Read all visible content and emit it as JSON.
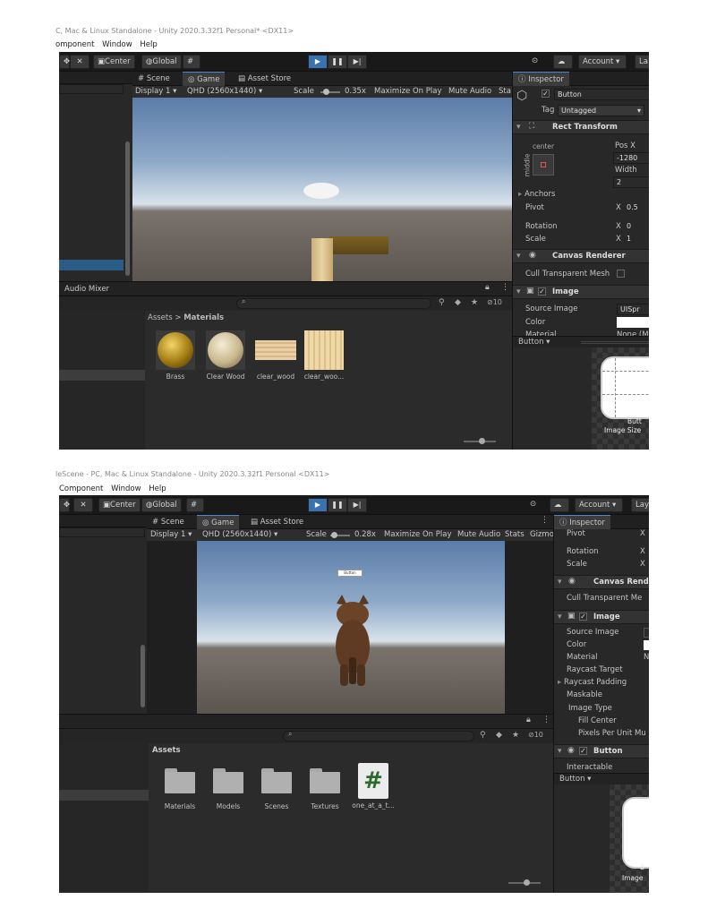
{
  "shot1": {
    "window_title": "C, Mac & Linux Standalone - Unity 2020.3.32f1 Personal* <DX11>",
    "menu": [
      "omponent",
      "Window",
      "Help"
    ],
    "toolbar": {
      "center": "Center",
      "global": "Global",
      "account": "Account",
      "layers": "La"
    },
    "tabs": {
      "scene": "Scene",
      "game": "Game",
      "asset_store": "Asset Store"
    },
    "game_bar": {
      "display": "Display 1",
      "resolution": "QHD (2560x1440)",
      "scale_label": "Scale",
      "scale_value": "0.35x",
      "maximize": "Maximize On Play",
      "mute": "Mute Audio",
      "stats": "Sta"
    },
    "audio_mixer_tab": "Audio Mixer",
    "breadcrumb": {
      "root": "Assets",
      "sep": ">",
      "leaf": "Materials"
    },
    "visible_count": "10",
    "assets": [
      "Brass",
      "Clear Wood",
      "clear_wood",
      "clear_woo..."
    ],
    "inspector": {
      "tab": "Inspector",
      "object_name": "Button",
      "tag_label": "Tag",
      "tag_value": "Untagged",
      "rect_transform": "Rect Transform",
      "anchor_preset": "center",
      "anchor_side": "middle",
      "pos_x_label": "Pos X",
      "pos_x_value": "-1280",
      "width_label": "Width",
      "width_value": "2",
      "anchors": "Anchors",
      "pivot_label": "Pivot",
      "pivot_x": "X",
      "pivot_value": "0.5",
      "rotation_label": "Rotation",
      "rotation_x": "X",
      "rotation_value": "0",
      "scale_label": "Scale",
      "scale_x": "X",
      "scale_value": "1",
      "canvas_renderer": "Canvas Renderer",
      "cull": "Cull Transparent Mesh",
      "image": "Image",
      "source_image_label": "Source Image",
      "source_image_value": "UISpr",
      "color_label": "Color",
      "material_label": "Material",
      "material_value": "None (M",
      "preview_title": "Button",
      "preview_caption_1": "Butt",
      "preview_caption_2": "Image Size"
    }
  },
  "shot2": {
    "window_title": "leScene - PC, Mac & Linux Standalone - Unity 2020.3.32f1 Personal <DX11>",
    "menu": [
      "Component",
      "Window",
      "Help"
    ],
    "toolbar": {
      "center": "Center",
      "global": "Global",
      "account": "Account",
      "layers": "Lay"
    },
    "tabs": {
      "scene": "Scene",
      "game": "Game",
      "asset_store": "Asset Store"
    },
    "game_bar": {
      "display": "Display 1",
      "resolution": "QHD (2560x1440)",
      "scale_label": "Scale",
      "scale_value": "0.28x",
      "maximize": "Maximize On Play",
      "mute": "Mute Audio",
      "stats": "Stats",
      "gizmos": "Gizmo"
    },
    "game_button_text": "Button",
    "assets_title": "Assets",
    "visible_count": "10",
    "assets": [
      "Materials",
      "Models",
      "Scenes",
      "Textures",
      "one_at_a_t..."
    ],
    "inspector": {
      "tab": "Inspector",
      "pivot": "Pivot",
      "rotation": "Rotation",
      "scale": "Scale",
      "axis_x": "X",
      "canvas_renderer": "Canvas Render",
      "cull": "Cull Transparent Me",
      "image": "Image",
      "source_image": "Source Image",
      "color": "Color",
      "material": "Material",
      "material_value": "N",
      "raycast_target": "Raycast Target",
      "raycast_padding": "Raycast Padding",
      "maskable": "Maskable",
      "image_type": "Image Type",
      "fill_center": "Fill Center",
      "pixels_per_unit": "Pixels Per Unit Mu",
      "button": "Button",
      "interactable": "Interactable",
      "preview_title": "Button",
      "preview_caption_1": "B",
      "preview_caption_2": "Image"
    }
  },
  "colors": {
    "accent": "#3a72b0",
    "panel": "#282828",
    "toolbar": "#191919"
  },
  "icons": [
    "hand-tool-icon",
    "move-tool-icon",
    "play-icon",
    "pause-icon",
    "step-icon",
    "cloud-icon",
    "collab-icon",
    "inspector-icon",
    "lock-icon",
    "menu-dots-icon",
    "search-icon",
    "cube-icon",
    "rect-transform-icon",
    "eye-icon",
    "image-icon",
    "folder-icon",
    "csharp-script-icon",
    "slider-icon"
  ]
}
